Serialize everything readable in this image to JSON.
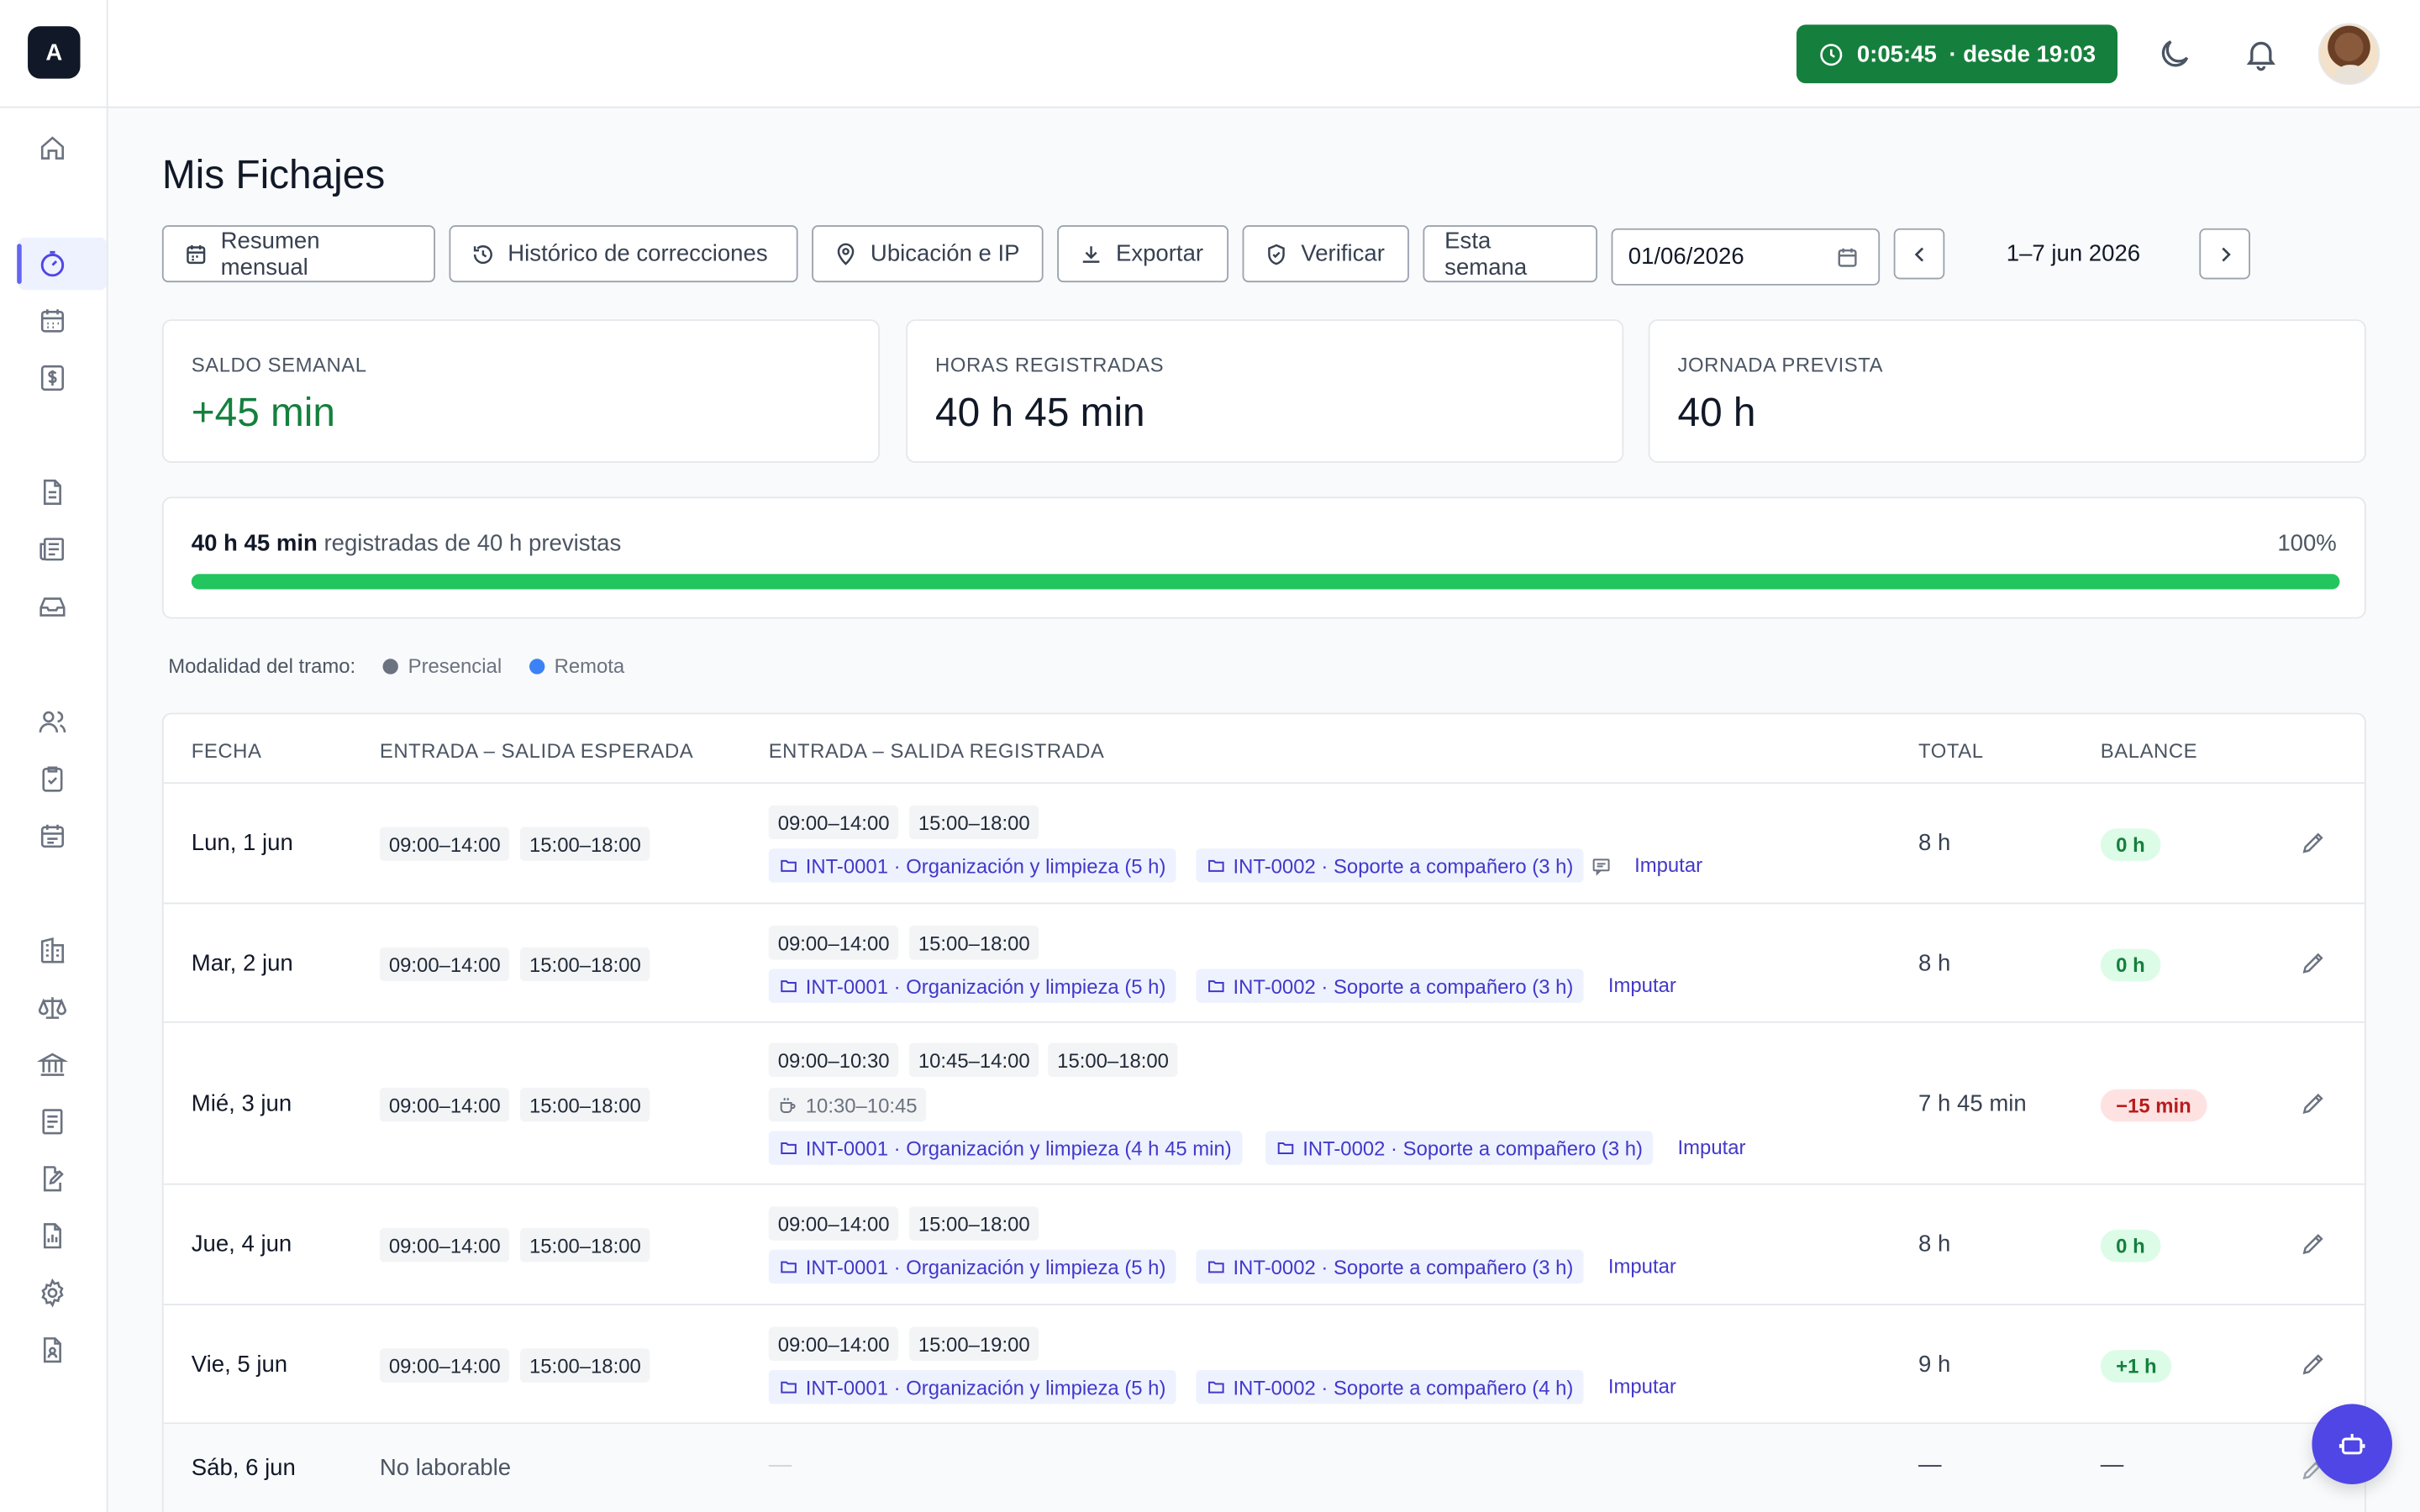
{
  "app": {
    "logo_letter": "A"
  },
  "timer": {
    "elapsed": "0:05:45",
    "since": "· desde 19:03"
  },
  "page": {
    "title": "Mis Fichajes"
  },
  "toolbar": {
    "monthly": "Resumen mensual",
    "history": "Histórico de correcciones",
    "location": "Ubicación e IP",
    "export": "Exportar",
    "verify": "Verificar",
    "this_week": "Esta semana",
    "date_value": "01/06/2026",
    "range": "1–7 jun 2026"
  },
  "cards": {
    "saldo": {
      "label": "SALDO SEMANAL",
      "value": "+45 min"
    },
    "horas": {
      "label": "HORAS REGISTRADAS",
      "value": "40 h 45 min"
    },
    "jornada": {
      "label": "JORNADA PREVISTA",
      "value": "40 h"
    }
  },
  "progress": {
    "registered": "40 h 45 min",
    "suffix": "registradas de 40 h previstas",
    "percent_label": "100%",
    "fraction": 1.0
  },
  "legend": {
    "label": "Modalidad del tramo:",
    "presencial": "Presencial",
    "remota": "Remota",
    "presencial_color": "#6b7280",
    "remota_color": "#3b82f6"
  },
  "table": {
    "headers": {
      "fecha": "FECHA",
      "esperada": "ENTRADA – SALIDA ESPERADA",
      "registrada": "ENTRADA – SALIDA REGISTRADA",
      "total": "TOTAL",
      "balance": "BALANCE"
    },
    "imputar": "Imputar",
    "rows": [
      {
        "date": "Lun, 1 jun",
        "exp1": "09:00–14:00",
        "exp2": "15:00–18:00",
        "reg": [
          "09:00–14:00",
          "15:00–18:00"
        ],
        "proj1": "INT-0001 · Organización y limpieza (5 h)",
        "proj2": "INT-0002 · Soporte a compañero (3 h)",
        "total": "8 h",
        "balance": "0 h"
      },
      {
        "date": "Mar, 2 jun",
        "exp1": "09:00–14:00",
        "exp2": "15:00–18:00",
        "reg": [
          "09:00–14:00",
          "15:00–18:00"
        ],
        "proj1": "INT-0001 · Organización y limpieza (5 h)",
        "proj2": "INT-0002 · Soporte a compañero (3 h)",
        "total": "8 h",
        "balance": "0 h"
      },
      {
        "date": "Mié, 3 jun",
        "exp1": "09:00–14:00",
        "exp2": "15:00–18:00",
        "reg": [
          "09:00–10:30",
          "10:45–14:00",
          "15:00–18:00"
        ],
        "break": "10:30–10:45",
        "proj1": "INT-0001 · Organización y limpieza (4 h 45 min)",
        "proj2": "INT-0002 · Soporte a compañero (3 h)",
        "total": "7 h 45 min",
        "balance": "−15 min"
      },
      {
        "date": "Jue, 4 jun",
        "exp1": "09:00–14:00",
        "exp2": "15:00–18:00",
        "reg": [
          "09:00–14:00",
          "15:00–18:00"
        ],
        "proj1": "INT-0001 · Organización y limpieza (5 h)",
        "proj2": "INT-0002 · Soporte a compañero (3 h)",
        "total": "8 h",
        "balance": "0 h"
      },
      {
        "date": "Vie, 5 jun",
        "exp1": "09:00–14:00",
        "exp2": "15:00–18:00",
        "reg": [
          "09:00–14:00",
          "15:00–19:00"
        ],
        "proj1": "INT-0001 · Organización y limpieza (5 h)",
        "proj2": "INT-0002 · Soporte a compañero (4 h)",
        "total": "9 h",
        "balance": "+1 h"
      },
      {
        "date": "Sáb, 6 jun",
        "no_work": "No laborable",
        "dash": "—"
      }
    ]
  }
}
